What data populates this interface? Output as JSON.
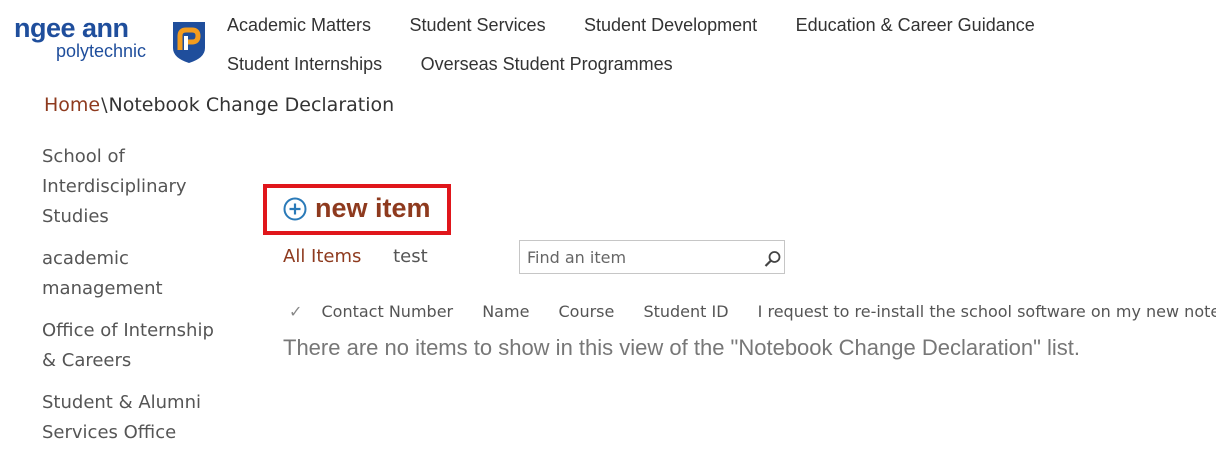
{
  "logo": {
    "line1": "ngee ann",
    "line2": "polytechnic"
  },
  "top_nav": [
    "Academic Matters",
    "Student Services",
    "Student Development",
    "Education & Career Guidance",
    "Student Internships",
    "Overseas Student Programmes"
  ],
  "breadcrumb": {
    "home": "Home",
    "separator": "\\",
    "current": "Notebook Change Declaration"
  },
  "left_nav": [
    "School of Interdisciplinary Studies",
    "academic management",
    "Office of Internship & Careers",
    "Student & Alumni Services Office"
  ],
  "new_item": {
    "label": "new item"
  },
  "views": {
    "active": "All Items",
    "other": "test"
  },
  "search": {
    "placeholder": "Find an item"
  },
  "columns": [
    "Contact Number",
    "Name",
    "Course",
    "Student ID",
    "I request to re-install the school software on my new notebook b"
  ],
  "check_glyph": "✓",
  "empty_message": "There are no items to show in this view of the \"Notebook Change Declaration\" list.",
  "colors": {
    "accent": "#8e3a1e",
    "highlight_box": "#e0161b",
    "logo_blue": "#1f4e9c",
    "logo_orange": "#f39c1f"
  },
  "icons": [
    "logo-mark-icon",
    "add-circle-icon",
    "search-icon",
    "checkmark-icon"
  ]
}
